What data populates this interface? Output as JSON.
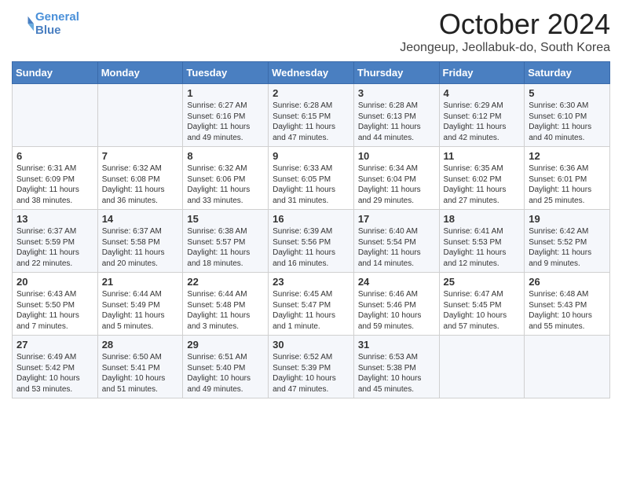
{
  "header": {
    "logo_line1": "General",
    "logo_line2": "Blue",
    "month": "October 2024",
    "location": "Jeongeup, Jeollabuk-do, South Korea"
  },
  "days_of_week": [
    "Sunday",
    "Monday",
    "Tuesday",
    "Wednesday",
    "Thursday",
    "Friday",
    "Saturday"
  ],
  "weeks": [
    [
      {
        "day": "",
        "content": ""
      },
      {
        "day": "",
        "content": ""
      },
      {
        "day": "1",
        "content": "Sunrise: 6:27 AM\nSunset: 6:16 PM\nDaylight: 11 hours and 49 minutes."
      },
      {
        "day": "2",
        "content": "Sunrise: 6:28 AM\nSunset: 6:15 PM\nDaylight: 11 hours and 47 minutes."
      },
      {
        "day": "3",
        "content": "Sunrise: 6:28 AM\nSunset: 6:13 PM\nDaylight: 11 hours and 44 minutes."
      },
      {
        "day": "4",
        "content": "Sunrise: 6:29 AM\nSunset: 6:12 PM\nDaylight: 11 hours and 42 minutes."
      },
      {
        "day": "5",
        "content": "Sunrise: 6:30 AM\nSunset: 6:10 PM\nDaylight: 11 hours and 40 minutes."
      }
    ],
    [
      {
        "day": "6",
        "content": "Sunrise: 6:31 AM\nSunset: 6:09 PM\nDaylight: 11 hours and 38 minutes."
      },
      {
        "day": "7",
        "content": "Sunrise: 6:32 AM\nSunset: 6:08 PM\nDaylight: 11 hours and 36 minutes."
      },
      {
        "day": "8",
        "content": "Sunrise: 6:32 AM\nSunset: 6:06 PM\nDaylight: 11 hours and 33 minutes."
      },
      {
        "day": "9",
        "content": "Sunrise: 6:33 AM\nSunset: 6:05 PM\nDaylight: 11 hours and 31 minutes."
      },
      {
        "day": "10",
        "content": "Sunrise: 6:34 AM\nSunset: 6:04 PM\nDaylight: 11 hours and 29 minutes."
      },
      {
        "day": "11",
        "content": "Sunrise: 6:35 AM\nSunset: 6:02 PM\nDaylight: 11 hours and 27 minutes."
      },
      {
        "day": "12",
        "content": "Sunrise: 6:36 AM\nSunset: 6:01 PM\nDaylight: 11 hours and 25 minutes."
      }
    ],
    [
      {
        "day": "13",
        "content": "Sunrise: 6:37 AM\nSunset: 5:59 PM\nDaylight: 11 hours and 22 minutes."
      },
      {
        "day": "14",
        "content": "Sunrise: 6:37 AM\nSunset: 5:58 PM\nDaylight: 11 hours and 20 minutes."
      },
      {
        "day": "15",
        "content": "Sunrise: 6:38 AM\nSunset: 5:57 PM\nDaylight: 11 hours and 18 minutes."
      },
      {
        "day": "16",
        "content": "Sunrise: 6:39 AM\nSunset: 5:56 PM\nDaylight: 11 hours and 16 minutes."
      },
      {
        "day": "17",
        "content": "Sunrise: 6:40 AM\nSunset: 5:54 PM\nDaylight: 11 hours and 14 minutes."
      },
      {
        "day": "18",
        "content": "Sunrise: 6:41 AM\nSunset: 5:53 PM\nDaylight: 11 hours and 12 minutes."
      },
      {
        "day": "19",
        "content": "Sunrise: 6:42 AM\nSunset: 5:52 PM\nDaylight: 11 hours and 9 minutes."
      }
    ],
    [
      {
        "day": "20",
        "content": "Sunrise: 6:43 AM\nSunset: 5:50 PM\nDaylight: 11 hours and 7 minutes."
      },
      {
        "day": "21",
        "content": "Sunrise: 6:44 AM\nSunset: 5:49 PM\nDaylight: 11 hours and 5 minutes."
      },
      {
        "day": "22",
        "content": "Sunrise: 6:44 AM\nSunset: 5:48 PM\nDaylight: 11 hours and 3 minutes."
      },
      {
        "day": "23",
        "content": "Sunrise: 6:45 AM\nSunset: 5:47 PM\nDaylight: 11 hours and 1 minute."
      },
      {
        "day": "24",
        "content": "Sunrise: 6:46 AM\nSunset: 5:46 PM\nDaylight: 10 hours and 59 minutes."
      },
      {
        "day": "25",
        "content": "Sunrise: 6:47 AM\nSunset: 5:45 PM\nDaylight: 10 hours and 57 minutes."
      },
      {
        "day": "26",
        "content": "Sunrise: 6:48 AM\nSunset: 5:43 PM\nDaylight: 10 hours and 55 minutes."
      }
    ],
    [
      {
        "day": "27",
        "content": "Sunrise: 6:49 AM\nSunset: 5:42 PM\nDaylight: 10 hours and 53 minutes."
      },
      {
        "day": "28",
        "content": "Sunrise: 6:50 AM\nSunset: 5:41 PM\nDaylight: 10 hours and 51 minutes."
      },
      {
        "day": "29",
        "content": "Sunrise: 6:51 AM\nSunset: 5:40 PM\nDaylight: 10 hours and 49 minutes."
      },
      {
        "day": "30",
        "content": "Sunrise: 6:52 AM\nSunset: 5:39 PM\nDaylight: 10 hours and 47 minutes."
      },
      {
        "day": "31",
        "content": "Sunrise: 6:53 AM\nSunset: 5:38 PM\nDaylight: 10 hours and 45 minutes."
      },
      {
        "day": "",
        "content": ""
      },
      {
        "day": "",
        "content": ""
      }
    ]
  ]
}
